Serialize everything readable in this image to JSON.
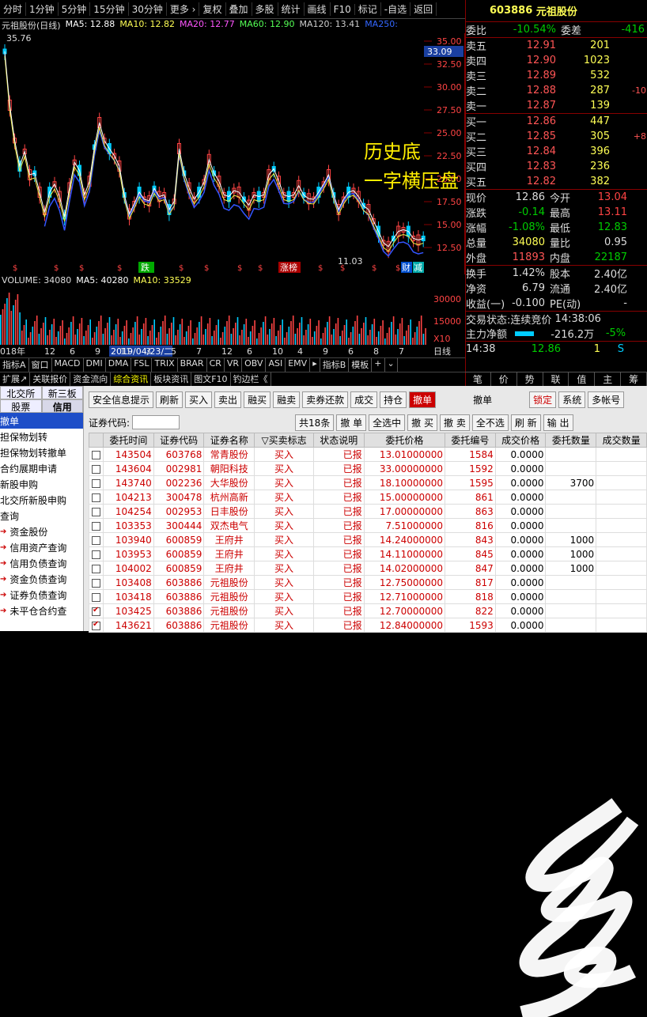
{
  "topbar": [
    "分时",
    "1分钟",
    "5分钟",
    "15分钟",
    "30分钟",
    "更多 ›",
    "复权",
    "叠加",
    "多股",
    "统计",
    "画线",
    "F10",
    "标记",
    "-自选",
    "返回"
  ],
  "chart": {
    "title": "元祖股份(日线)",
    "ma": [
      {
        "label": "MA5: 12.88",
        "color": "#ffffff"
      },
      {
        "label": "MA10: 12.82",
        "color": "#ffff55"
      },
      {
        "label": "MA20: 12.77",
        "color": "#ff55ff"
      },
      {
        "label": "MA60: 12.90",
        "color": "#55ff55"
      },
      {
        "label": "MA120: 13.41",
        "color": "#cccccc"
      },
      {
        "label": "MA250:",
        "color": "#3366ff"
      }
    ],
    "yticks": [
      "35.00",
      "32.50",
      "30.00",
      "27.50",
      "25.00",
      "22.50",
      "20.00",
      "17.50",
      "15.00",
      "12.50"
    ],
    "high_label": "35.76",
    "low_label": "11.03",
    "price_tag": "33.09",
    "annotation1": "历史底",
    "annotation2": "一字横压盘",
    "markers": [
      "跌",
      "涨榜",
      "财",
      "减"
    ]
  },
  "volume": {
    "label": "VOLUME: 34080",
    "ma5": "MA5: 40280",
    "ma10": "MA10: 33529",
    "yticks": [
      "30000",
      "15000"
    ],
    "unit": "X10"
  },
  "timeline": {
    "start": "018年",
    "selected": "2019/04/23/二",
    "items": [
      "12",
      "6",
      "9",
      "11",
      "3",
      "5",
      "7",
      "12",
      "6",
      "10",
      "4",
      "9",
      "6",
      "8",
      "7"
    ],
    "end": "日线"
  },
  "indicators": [
    "指标A",
    "窗口",
    "MACD",
    "DMI",
    "DMA",
    "FSL",
    "TRIX",
    "BRAR",
    "CR",
    "VR",
    "OBV",
    "ASI",
    "EMV",
    "▸",
    "指标B",
    "模板",
    "+",
    "⌄"
  ],
  "subtabs": [
    "扩展↗",
    "关联报价",
    "资金流向",
    "综合资讯",
    "板块资讯",
    "图文F10",
    "钓边栏《"
  ],
  "quote": {
    "code": "603886",
    "name": "元祖股份",
    "weibi": "-10.54%",
    "weicha": "-416",
    "sells": [
      {
        "label": "卖五",
        "price": "12.91",
        "vol": "201",
        "x": ""
      },
      {
        "label": "卖四",
        "price": "12.90",
        "vol": "1023",
        "x": ""
      },
      {
        "label": "卖三",
        "price": "12.89",
        "vol": "532",
        "x": ""
      },
      {
        "label": "卖二",
        "price": "12.88",
        "vol": "287",
        "x": "-10"
      },
      {
        "label": "卖一",
        "price": "12.87",
        "vol": "139",
        "x": ""
      }
    ],
    "buys": [
      {
        "label": "买一",
        "price": "12.86",
        "vol": "447",
        "x": ""
      },
      {
        "label": "买二",
        "price": "12.85",
        "vol": "305",
        "x": "+8"
      },
      {
        "label": "买三",
        "price": "12.84",
        "vol": "396",
        "x": ""
      },
      {
        "label": "买四",
        "price": "12.83",
        "vol": "236",
        "x": ""
      },
      {
        "label": "买五",
        "price": "12.82",
        "vol": "382",
        "x": ""
      }
    ],
    "stats": [
      {
        "a": "现价",
        "b": "12.86",
        "c": "今开",
        "d": "13.04"
      },
      {
        "a": "涨跌",
        "b": "-0.14",
        "c": "最高",
        "d": "13.11"
      },
      {
        "a": "涨幅",
        "b": "-1.08%",
        "c": "最低",
        "d": "12.83"
      },
      {
        "a": "总量",
        "b": "34080",
        "c": "量比",
        "d": "0.95"
      },
      {
        "a": "外盘",
        "b": "11893",
        "c": "内盘",
        "d": "22187"
      }
    ],
    "stats2": [
      {
        "a": "换手",
        "b": "1.42%",
        "c": "股本",
        "d": "2.40亿"
      },
      {
        "a": "净资",
        "b": "6.79",
        "c": "流通",
        "d": "2.40亿"
      },
      {
        "a": "收益(一)",
        "b": "-0.100",
        "c": "PE(动)",
        "d": "-"
      }
    ],
    "status_label": "交易状态:",
    "status_val": "连续竞价",
    "status_time": "14:38:06",
    "flow_label": "主力净额",
    "flow_val": "-216.2万",
    "flow_pct": "-5%",
    "tick": {
      "time": "14:38",
      "price": "12.86",
      "vol": "1",
      "flag": "S"
    },
    "tabs": [
      "笔",
      "价",
      "势",
      "联",
      "值",
      "主",
      "筹"
    ]
  },
  "bottom": {
    "left_tabs": [
      "北交所",
      "新三板",
      "股票",
      "信用"
    ],
    "left_items": [
      "撤单",
      "担保物划转",
      "担保物划转撤单",
      "合约展期申请",
      "新股申购",
      "北交所新股申购",
      "查询"
    ],
    "left_sub": [
      "资金股份",
      "信用资产查询",
      "信用负债查询",
      "资金负债查询",
      "证券负债查询",
      "未平仓合约查"
    ],
    "toolbar": [
      "安全信息提示",
      "刷新",
      "买入",
      "卖出",
      "融买",
      "融卖",
      "卖券还款",
      "成交",
      "持仓",
      "撤单",
      "撤单",
      "锁定",
      "系统",
      "多帐号"
    ],
    "search_label": "证券代码:",
    "total": "共18条",
    "actions": [
      "撤 单",
      "全选中",
      "撤 买",
      "撤 卖",
      "全不选",
      "刷 新",
      "输 出"
    ],
    "headers": [
      "",
      "委托时间",
      "证券代码",
      "证券名称",
      "▽买卖标志",
      "状态说明",
      "委托价格",
      "委托编号",
      "成交价格",
      "委托数量",
      "成交数量"
    ],
    "rows": [
      {
        "chk": false,
        "t": "143504",
        "code": "603768",
        "name": "常青股份",
        "side": "买入",
        "st": "已报",
        "price": "13.01000000",
        "no": "1584",
        "p2": "0.0000",
        "q": "",
        "d": ""
      },
      {
        "chk": false,
        "t": "143604",
        "code": "002981",
        "name": "朝阳科技",
        "side": "买入",
        "st": "已报",
        "price": "33.00000000",
        "no": "1592",
        "p2": "0.0000",
        "q": "",
        "d": ""
      },
      {
        "chk": false,
        "t": "143740",
        "code": "002236",
        "name": "大华股份",
        "side": "买入",
        "st": "已报",
        "price": "18.10000000",
        "no": "1595",
        "p2": "0.0000",
        "q": "3700",
        "d": ""
      },
      {
        "chk": false,
        "t": "104213",
        "code": "300478",
        "name": "杭州高新",
        "side": "买入",
        "st": "已报",
        "price": "15.00000000",
        "no": "861",
        "p2": "0.0000",
        "q": "",
        "d": ""
      },
      {
        "chk": false,
        "t": "104254",
        "code": "002953",
        "name": "日丰股份",
        "side": "买入",
        "st": "已报",
        "price": "17.00000000",
        "no": "863",
        "p2": "0.0000",
        "q": "",
        "d": ""
      },
      {
        "chk": false,
        "t": "103353",
        "code": "300444",
        "name": "双杰电气",
        "side": "买入",
        "st": "已报",
        "price": "7.51000000",
        "no": "816",
        "p2": "0.0000",
        "q": "",
        "d": ""
      },
      {
        "chk": false,
        "t": "103940",
        "code": "600859",
        "name": "王府井",
        "side": "买入",
        "st": "已报",
        "price": "14.24000000",
        "no": "843",
        "p2": "0.0000",
        "q": "1000",
        "d": ""
      },
      {
        "chk": false,
        "t": "103953",
        "code": "600859",
        "name": "王府井",
        "side": "买入",
        "st": "已报",
        "price": "14.11000000",
        "no": "845",
        "p2": "0.0000",
        "q": "1000",
        "d": ""
      },
      {
        "chk": false,
        "t": "104002",
        "code": "600859",
        "name": "王府井",
        "side": "买入",
        "st": "已报",
        "price": "14.02000000",
        "no": "847",
        "p2": "0.0000",
        "q": "1000",
        "d": ""
      },
      {
        "chk": false,
        "t": "103408",
        "code": "603886",
        "name": "元祖股份",
        "side": "买入",
        "st": "已报",
        "price": "12.75000000",
        "no": "817",
        "p2": "0.0000",
        "q": "",
        "d": ""
      },
      {
        "chk": false,
        "t": "103418",
        "code": "603886",
        "name": "元祖股份",
        "side": "买入",
        "st": "已报",
        "price": "12.71000000",
        "no": "818",
        "p2": "0.0000",
        "q": "",
        "d": ""
      },
      {
        "chk": true,
        "t": "103425",
        "code": "603886",
        "name": "元祖股份",
        "side": "买入",
        "st": "已报",
        "price": "12.70000000",
        "no": "822",
        "p2": "0.0000",
        "q": "",
        "d": ""
      },
      {
        "chk": true,
        "t": "143621",
        "code": "603886",
        "name": "元祖股份",
        "side": "买入",
        "st": "已报",
        "price": "12.84000000",
        "no": "1593",
        "p2": "0.0000",
        "q": "",
        "d": ""
      }
    ]
  }
}
